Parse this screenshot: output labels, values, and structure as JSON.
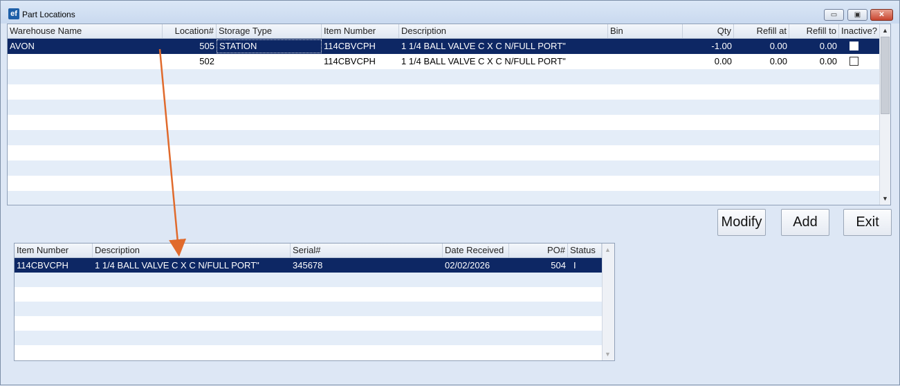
{
  "window": {
    "title": "Part Locations",
    "icon": "ef",
    "controls": {
      "minimize": "▭",
      "maximize": "▣",
      "close": "✕"
    }
  },
  "locations_grid": {
    "columns": [
      "Warehouse Name",
      "Location#",
      "Storage Type",
      "Item Number",
      "Description",
      "Bin",
      "Qty",
      "Refill at",
      "Refill to",
      "Inactive?"
    ],
    "rows": [
      {
        "warehouse": "AVON",
        "location": "505",
        "storage_type": "STATION",
        "item_number": "114CBVCPH",
        "description": "1 1/4 BALL VALVE C X C N/FULL PORT\"",
        "bin": "",
        "qty": "-1.00",
        "refill_at": "0.00",
        "refill_to": "0.00",
        "inactive": false,
        "selected": true
      },
      {
        "warehouse": "",
        "location": "502",
        "storage_type": "",
        "item_number": "114CBVCPH",
        "description": "1 1/4 BALL VALVE C X C N/FULL PORT\"",
        "bin": "",
        "qty": "0.00",
        "refill_at": "0.00",
        "refill_to": "0.00",
        "inactive": false,
        "selected": false
      }
    ]
  },
  "buttons": {
    "modify": "Modify",
    "add": "Add",
    "exit": "Exit"
  },
  "serials_grid": {
    "columns": [
      "Item Number",
      "Description",
      "Serial#",
      "Date Received",
      "PO#",
      "Status"
    ],
    "rows": [
      {
        "item_number": "114CBVCPH",
        "description": "1 1/4 BALL VALVE C X C N/FULL PORT\"",
        "serial": "345678",
        "date_received": "02/02/2026",
        "po": "504",
        "status": "I",
        "selected": true
      }
    ]
  },
  "colors": {
    "selected_row": "#0d2764",
    "stripe_row": "#e4edf8",
    "annotation_arrow": "#e06a2c"
  }
}
